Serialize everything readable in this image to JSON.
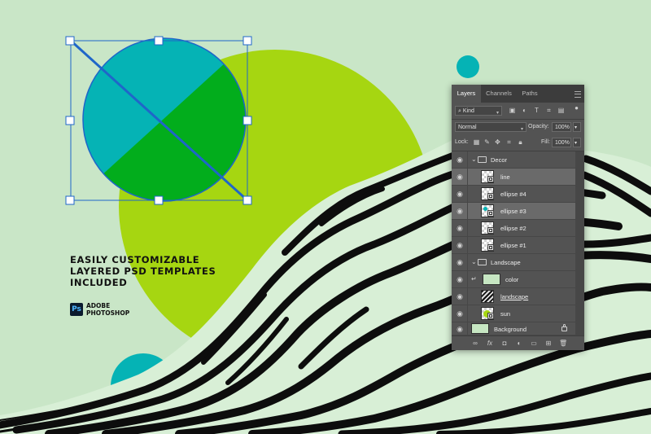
{
  "promo": {
    "lines": [
      "EASILY CUSTOMIZABLE",
      "LAYERED PSD TEMPLATES",
      "INCLUDED"
    ],
    "app_badge": "Ps",
    "app_name_lines": [
      "ADOBE",
      "PHOTOSHOP"
    ]
  },
  "colors": {
    "background": "#c9e6c7",
    "sun": "#a6d611",
    "ellipse_teal": "#05b3b5",
    "ellipse_green": "#02ad1c",
    "selection": "#1f66c9",
    "stripe_dark": "#0d0d0d",
    "stripe_light": "#d8efd6",
    "panel_bg": "#535353",
    "panel_tabbar": "#3c3c3c"
  },
  "panel": {
    "tabs": [
      "Layers",
      "Channels",
      "Paths"
    ],
    "active_tab": "Layers",
    "filter_kind": "Kind",
    "blend_mode": "Normal",
    "opacity_label": "Opacity:",
    "opacity_value": "100%",
    "lock_label": "Lock:",
    "fill_label": "Fill:",
    "fill_value": "100%",
    "layers": [
      {
        "name": "Decor",
        "kind": "group"
      },
      {
        "name": "line",
        "kind": "smart"
      },
      {
        "name": "ellipse #4",
        "kind": "smart"
      },
      {
        "name": "ellipse #3",
        "kind": "smart",
        "selected": true
      },
      {
        "name": "ellipse #2",
        "kind": "smart"
      },
      {
        "name": "ellipse #1",
        "kind": "smart"
      },
      {
        "name": "Landscape",
        "kind": "group"
      },
      {
        "name": "color",
        "kind": "fill"
      },
      {
        "name": "landscape",
        "kind": "image"
      },
      {
        "name": "sun",
        "kind": "smart"
      },
      {
        "name": "Background",
        "kind": "background"
      }
    ],
    "bottom_icons": [
      "link-icon",
      "fx-icon",
      "mask-icon",
      "adjustment-icon",
      "folder-icon",
      "new-layer-icon",
      "trash-icon"
    ]
  }
}
